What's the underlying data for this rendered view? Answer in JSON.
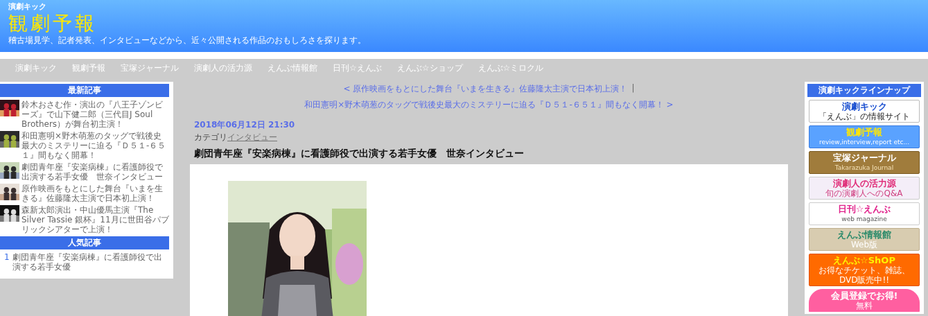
{
  "header": {
    "site_label": "演劇キック",
    "title": "観劇予報",
    "tagline": "稽古場見学、記者発表、インタビューなどから、近々公開される作品のおもしろさを探ります。"
  },
  "nav": [
    "演劇キック",
    "観劇予報",
    "宝塚ジャーナル",
    "演劇人の活力源",
    "えんぶ情報館",
    "日刊☆えんぶ",
    "えんぶ☆ショップ",
    "えんぶ☆ミロクル"
  ],
  "sidebar_left": {
    "heading": "最新記事",
    "articles": [
      {
        "title": "鈴木おさむ作・演出の『八王子ゾンビーズ』で山下健二郎（三代目J Soul Brothers）が舞台初主演！"
      },
      {
        "title": "和田憲明×野木萌葱のタッグで戦後史最大のミステリーに迫る『Ｄ５１-６５１』間もなく開幕！"
      },
      {
        "title": "劇団青年座『安楽病棟』に看護師役で出演する若手女優　世奈インタビュー"
      },
      {
        "title": "原作映画をもとにした舞台『いまを生きる』佐藤隆太主演で日本初上演！"
      },
      {
        "title": "森新太郎演出・中山優馬主演『The Silver Tassie 銀杯』11月に世田谷パブリックシアターで上演！"
      }
    ],
    "ranking_heading": "人気記事",
    "ranking": [
      {
        "rank": "1",
        "title": "劇団青年座『安楽病棟』に看護師役で出演する若手女優"
      }
    ]
  },
  "post_nav": {
    "prev": "< 原作映画をもとにした舞台『いまを生きる』佐藤隆太主演で日本初上演！",
    "separator": "|",
    "next": "和田憲明×野木萌葱のタッグで戦後史最大のミステリーに迫る『Ｄ５１-６５１』間もなく開幕！ >"
  },
  "post": {
    "date": "2018年06月12日 21:30",
    "category_label": "カテゴリ",
    "category": "インタビュー",
    "title": "劇団青年座『安楽病棟』に看護師役で出演する若手女優　世奈インタビュー"
  },
  "sidebar_right": {
    "heading": "演劇キックラインナップ",
    "banners": [
      {
        "kind": "kick",
        "title": "演劇キック",
        "sub": "「えんぶ」の情報サイト"
      },
      {
        "kind": "yoho",
        "title": "観劇予報",
        "sub": "review,interview,report etc..."
      },
      {
        "kind": "takarazuka",
        "title": "宝塚ジャーナル",
        "sub": "Takarazuka Journal"
      },
      {
        "kind": "katsuryoku",
        "title": "演劇人の活力源",
        "sub": "旬の演劇人へのQ&A"
      },
      {
        "kind": "nikkan",
        "title": "日刊☆えんぶ",
        "sub": "web magazine"
      },
      {
        "kind": "johokan",
        "title": "えんぶ情報館",
        "sub": "Web版"
      },
      {
        "kind": "shop",
        "title": "えんぶ☆ShOP",
        "sub": "お得なチケット、雑誌、DVD販売中!!"
      },
      {
        "kind": "mirokuru",
        "title": "会員登録でお得!",
        "sub": "無料"
      }
    ]
  }
}
